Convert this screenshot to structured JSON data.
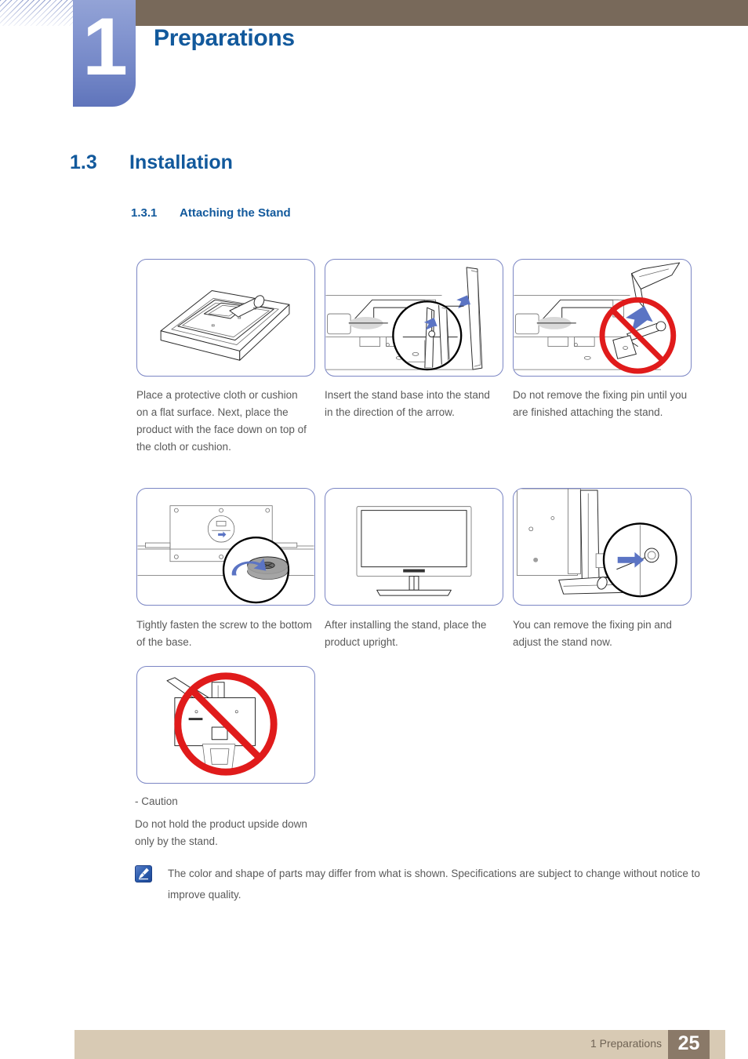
{
  "header": {
    "chapter_number": "1",
    "chapter_title": "Preparations",
    "bar_color": "#78695a",
    "tab_color": "#7f93ce",
    "title_color": "#12599c"
  },
  "section": {
    "number": "1.3",
    "title": "Installation",
    "subsection_number": "1.3.1",
    "subsection_title": "Attaching the Stand"
  },
  "steps": [
    {
      "id": "step-1",
      "illustration": "monitor-face-down-on-cushion",
      "caption": "Place a protective cloth or cushion on a flat surface. Next, place the product with the face down on top of the cloth or cushion."
    },
    {
      "id": "step-2",
      "illustration": "insert-stand-base-with-magnifier",
      "caption": "Insert the stand base into the stand in the direction of the arrow."
    },
    {
      "id": "step-3",
      "illustration": "do-not-remove-fixing-pin-prohibited",
      "caption": "Do not remove the fixing pin until you are finished attaching the stand."
    },
    {
      "id": "step-4",
      "illustration": "fasten-screw-bottom-of-base",
      "caption": "Tightly fasten the screw to the bottom of the base."
    },
    {
      "id": "step-5",
      "illustration": "monitor-upright-assembled",
      "caption": "After installing the stand, place the product upright."
    },
    {
      "id": "step-6",
      "illustration": "remove-fixing-pin-with-magnifier",
      "caption": "You can remove the fixing pin and adjust the stand now."
    }
  ],
  "caution": {
    "illustration": "do-not-hold-upside-down-prohibited",
    "label": "- Caution",
    "text": "Do not hold the product upside down only by the stand."
  },
  "note": {
    "icon": "note-pen-icon",
    "text": "The color and shape of parts may differ from what is shown. Specifications are subject to change without notice to improve quality."
  },
  "footer": {
    "label": "1 Preparations",
    "page_number": "25",
    "bar_color": "#d8cab4",
    "page_box_color": "#8a7968"
  }
}
